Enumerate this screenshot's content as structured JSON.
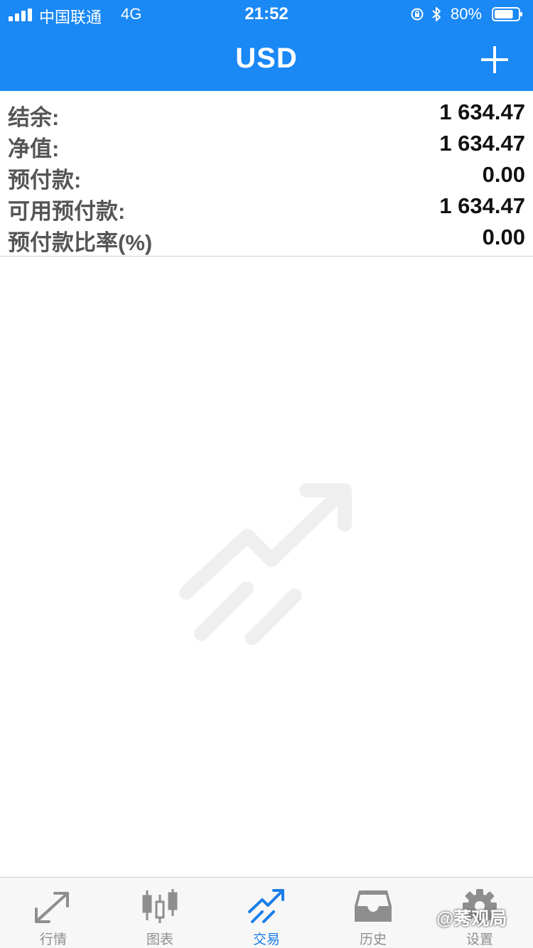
{
  "status_bar": {
    "carrier": "中国联通",
    "network": "4G",
    "time": "21:52",
    "battery": "80%",
    "battery_level": 0.8
  },
  "header": {
    "title": "USD",
    "add_icon": "plus-icon",
    "background_color": "#1a88f5"
  },
  "account": {
    "rows": [
      {
        "label": "结余:",
        "value": "1 634.47"
      },
      {
        "label": "净值:",
        "value": "1 634.47"
      },
      {
        "label": "预付款:",
        "value": "0.00"
      },
      {
        "label": "可用预付款:",
        "value": "1 634.47"
      },
      {
        "label": "预付款比率(%)",
        "value": "0.00"
      }
    ]
  },
  "empty_state": {
    "icon": "trade-trend-icon"
  },
  "tabs": [
    {
      "label": "行情",
      "icon": "quotes-arrows-icon",
      "active": false
    },
    {
      "label": "图表",
      "icon": "candlestick-chart-icon",
      "active": false
    },
    {
      "label": "交易",
      "icon": "trade-trend-icon",
      "active": true
    },
    {
      "label": "历史",
      "icon": "history-inbox-icon",
      "active": false
    },
    {
      "label": "设置",
      "icon": "gear-icon",
      "active": false
    }
  ],
  "overlay_watermark": "@莠观局",
  "colors": {
    "accent": "#1a7fe8",
    "tab_inactive": "#8e8e8e"
  }
}
